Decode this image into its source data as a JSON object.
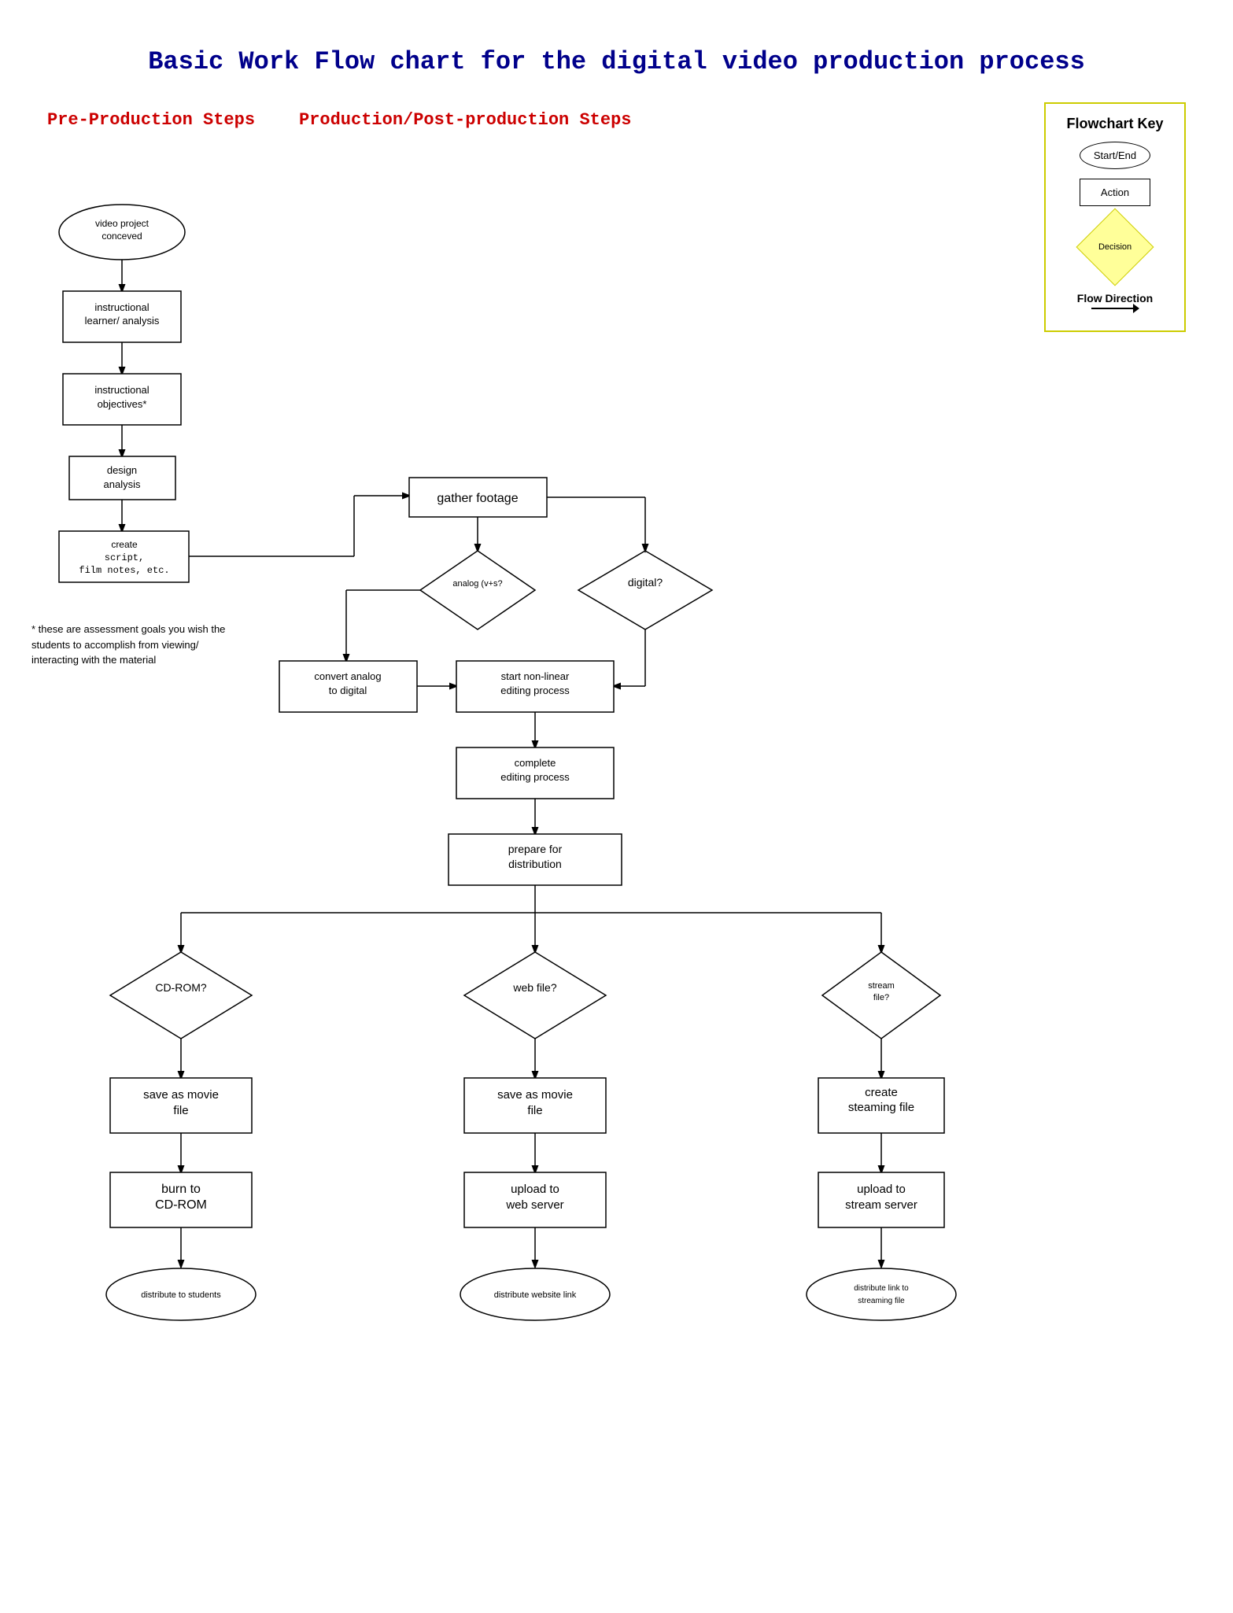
{
  "page": {
    "title": "Basic Work Flow chart for the digital video production process",
    "sections": {
      "preproduction_label": "Pre-Production Steps",
      "production_label": "Production/Post-production Steps"
    },
    "key": {
      "title": "Flowchart Key",
      "start_end": "Start/End",
      "action": "Action",
      "decision": "Decision",
      "flow_direction": "Flow Direction"
    },
    "nodes": {
      "video_project": "video project conceved",
      "instructional_learner": "instructional learner/ analysis",
      "instructional_objectives": "instructional objectives*",
      "design_analysis": "design analysis",
      "create_script": "create script, film notes, etc.",
      "gather_footage": "gather footage",
      "analog_vhs": "analog (v+s?",
      "digital": "digital?",
      "convert_analog": "convert analog to digital",
      "start_nonlinear": "start non-linear editing process",
      "complete_editing": "complete editing process",
      "prepare_distribution": "prepare for distribution",
      "cdrom_decision": "CD-ROM?",
      "web_file_decision": "web file?",
      "stream_file_decision": "stream file?",
      "save_movie_cdrom": "save as movie file",
      "save_movie_web": "save as movie file",
      "create_streaming": "create steaming file",
      "burn_cdrom": "burn to CD-ROM",
      "upload_web": "upload to web server",
      "upload_stream": "upload to stream server",
      "distribute_students": "distribute to students",
      "distribute_website": "distribute website link",
      "distribute_streaming": "distribute link to streaming file"
    },
    "footnote": "* these are assessment goals you wish the students to accomplish from viewing/ interacting with the material"
  }
}
